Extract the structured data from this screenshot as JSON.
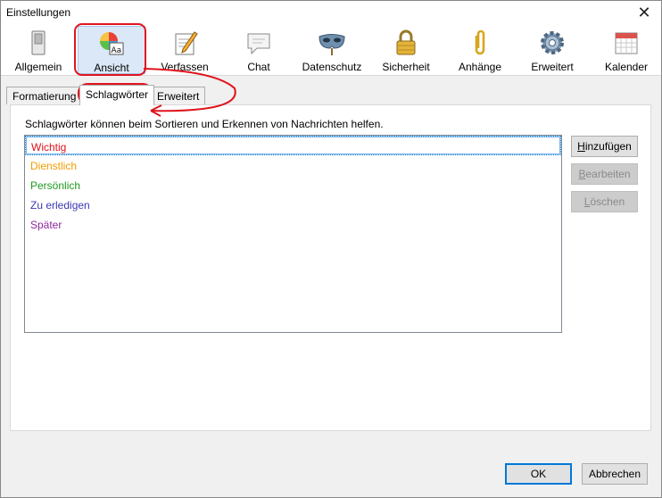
{
  "window": {
    "title": "Einstellungen",
    "close_glyph": "✕"
  },
  "toolbar": {
    "items": [
      {
        "label": "Allgemein",
        "icon": "switch-icon"
      },
      {
        "label": "Ansicht",
        "icon": "palette-font-icon"
      },
      {
        "label": "Verfassen",
        "icon": "compose-pencil-icon"
      },
      {
        "label": "Chat",
        "icon": "chat-bubble-icon"
      },
      {
        "label": "Datenschutz",
        "icon": "mask-icon"
      },
      {
        "label": "Sicherheit",
        "icon": "padlock-icon"
      },
      {
        "label": "Anhänge",
        "icon": "paperclip-icon"
      },
      {
        "label": "Erweitert",
        "icon": "gear-icon"
      },
      {
        "label": "Kalender",
        "icon": "calendar-icon"
      }
    ],
    "active": "Ansicht"
  },
  "tabs": [
    {
      "label": "Formatierung"
    },
    {
      "label": "Schlagwörter"
    },
    {
      "label": "Erweitert"
    }
  ],
  "panel": {
    "description": "Schlagwörter können beim Sortieren und Erkennen von Nachrichten helfen.",
    "tags": [
      {
        "label": "Wichtig",
        "color": "#e0121b"
      },
      {
        "label": "Dienstlich",
        "color": "#f29c00"
      },
      {
        "label": "Persönlich",
        "color": "#1e9a1e"
      },
      {
        "label": "Zu erledigen",
        "color": "#3c37b4"
      },
      {
        "label": "Später",
        "color": "#8c2a9c"
      }
    ],
    "buttons": {
      "add": {
        "pre": "",
        "key": "H",
        "post": "inzufügen"
      },
      "edit": {
        "pre": "",
        "key": "B",
        "post": "earbeiten"
      },
      "delete": {
        "pre": "",
        "key": "L",
        "post": "öschen"
      }
    }
  },
  "footer": {
    "ok": "OK",
    "cancel": "Abbrechen"
  },
  "colors": {
    "annotation": "#e0141e",
    "active_bg": "#dbe8f8",
    "focus": "#0078d7"
  }
}
